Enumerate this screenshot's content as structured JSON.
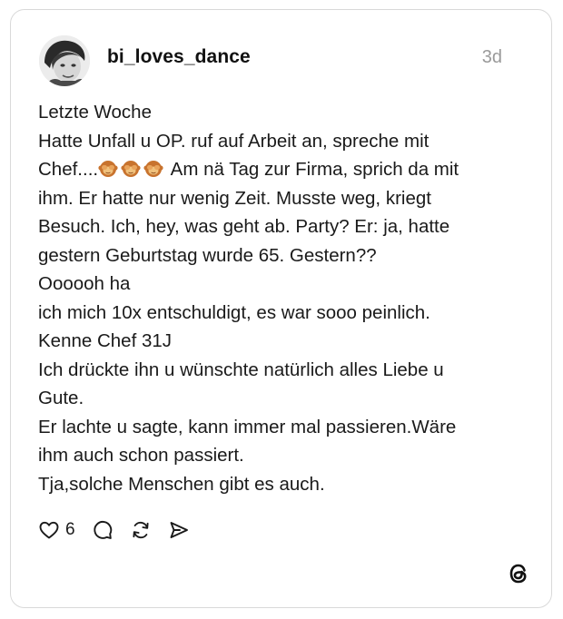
{
  "post": {
    "username": "bi_loves_dance",
    "time": "3d",
    "lines": [
      "Letzte Woche",
      "Hatte Unfall u OP. ruf auf Arbeit an, spreche mit",
      "Chef....",
      " Am nä Tag zur Firma, sprich da mit",
      "ihm. Er hatte nur wenig Zeit. Musste weg, kriegt",
      "Besuch. Ich, hey, was geht ab. Party? Er: ja, hatte",
      "gestern Geburtstag wurde 65. Gestern??",
      "Oooooh ha",
      "ich mich 10x entschuldigt, es war sooo peinlich.",
      "Kenne Chef 31J",
      "Ich drückte ihn u wünschte natürlich alles Liebe u",
      "Gute.",
      "Er lachte u sagte, kann immer mal passieren.Wäre",
      "ihm auch schon passiert.",
      "Tja,solche Menschen gibt es auch."
    ],
    "emoji_icons": [
      "see-no-evil-monkey-icon",
      "see-no-evil-monkey-icon",
      "see-no-evil-monkey-icon"
    ],
    "like_count": "6"
  },
  "actions": {
    "like_icon": "heart-icon",
    "reply_icon": "speech-bubble-icon",
    "repost_icon": "repost-icon",
    "share_icon": "send-icon"
  },
  "brand": {
    "logo_icon": "threads-logo-icon"
  },
  "colors": {
    "text": "#1a1a1a",
    "muted": "#9a9a9a",
    "border": "#d9d9d9",
    "emoji": "#c8732e"
  }
}
